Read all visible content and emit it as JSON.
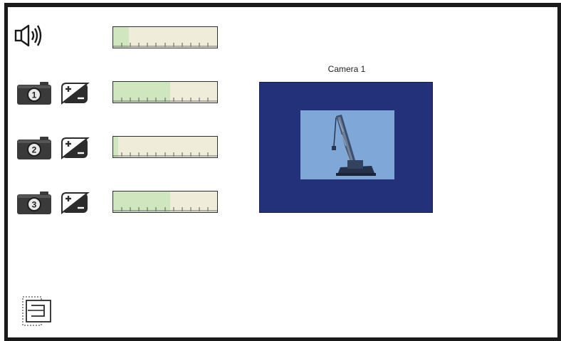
{
  "camera_view": {
    "title": "Camera 1"
  },
  "volume": {
    "icon": "speaker-icon",
    "level": 0.15
  },
  "cameras": [
    {
      "number": "1",
      "icon": "camera-icon",
      "brightness_icon": "brightness-contrast-icon",
      "level": 0.55
    },
    {
      "number": "2",
      "icon": "camera-icon",
      "brightness_icon": "brightness-contrast-icon",
      "level": 0.05
    },
    {
      "number": "3",
      "icon": "camera-icon",
      "brightness_icon": "brightness-contrast-icon",
      "level": 0.55
    }
  ],
  "menu": {
    "icon": "layout-menu-icon"
  },
  "colors": {
    "frame": "#1a1a1a",
    "bar_background": "#efedd9",
    "bar_fill": "#cfe6bf",
    "view_background": "#23317a",
    "image_background": "#7fa7d8"
  }
}
